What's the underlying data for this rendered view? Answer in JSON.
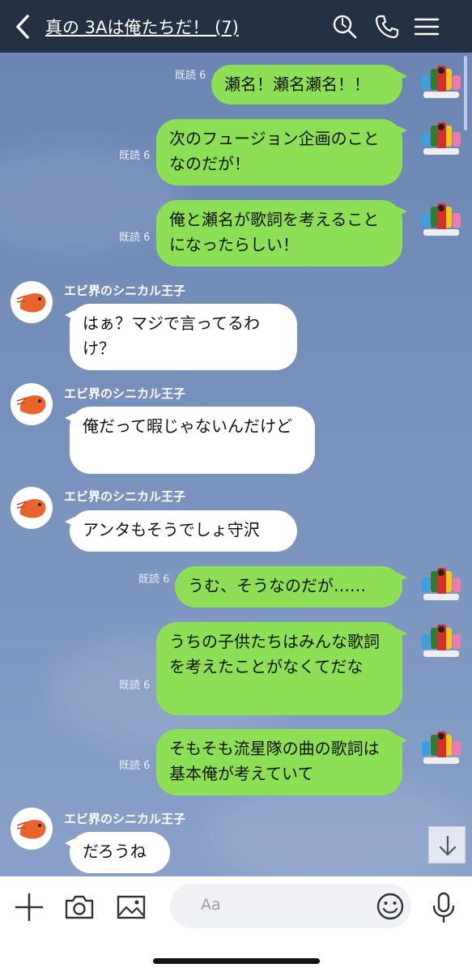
{
  "header": {
    "title": "真の 3Aは俺たちだ！ (7)"
  },
  "messages": {
    "m1": {
      "text": "瀬名！瀬名瀬名！！",
      "read": "既読 6"
    },
    "m2": {
      "text": "次のフュージョン企画のことなのだが！",
      "read": "既読 6"
    },
    "m3": {
      "text": "俺と瀬名が歌詞を考えることになったらしい！",
      "read": "既読 6"
    },
    "m4": {
      "sender": "エビ界のシニカル王子",
      "text": "はぁ？マジで言ってるわけ？"
    },
    "m5": {
      "sender": "エビ界のシニカル王子",
      "text": "俺だって暇じゃないんだけど"
    },
    "m6": {
      "sender": "エビ界のシニカル王子",
      "text": "アンタもそうでしょ守沢"
    },
    "m7": {
      "text": "うむ、そうなのだが……",
      "read": "既読 6"
    },
    "m8": {
      "text": "うちの子供たちはみんな歌詞を考えたことがなくてだな",
      "read": "既読 6"
    },
    "m9": {
      "text": "そもそも流星隊の曲の歌詞は基本俺が考えていて",
      "read": "既読 6"
    },
    "m10": {
      "sender": "エビ界のシニカル王子",
      "text": "だろうね"
    }
  },
  "input": {
    "placeholder": "Aa"
  },
  "icons": {
    "back": "chevron-left-icon",
    "search": "search-icon",
    "call": "phone-icon",
    "menu": "menu-icon",
    "add": "plus-icon",
    "camera": "camera-icon",
    "image": "image-icon",
    "emoji": "emoji-icon",
    "mic": "microphone-icon",
    "scroll_down": "arrow-down-icon"
  },
  "colors": {
    "header_bg": "#243043",
    "chat_bg": "#7690bb",
    "my_bubble": "#8de055",
    "their_bubble": "#ffffff"
  }
}
